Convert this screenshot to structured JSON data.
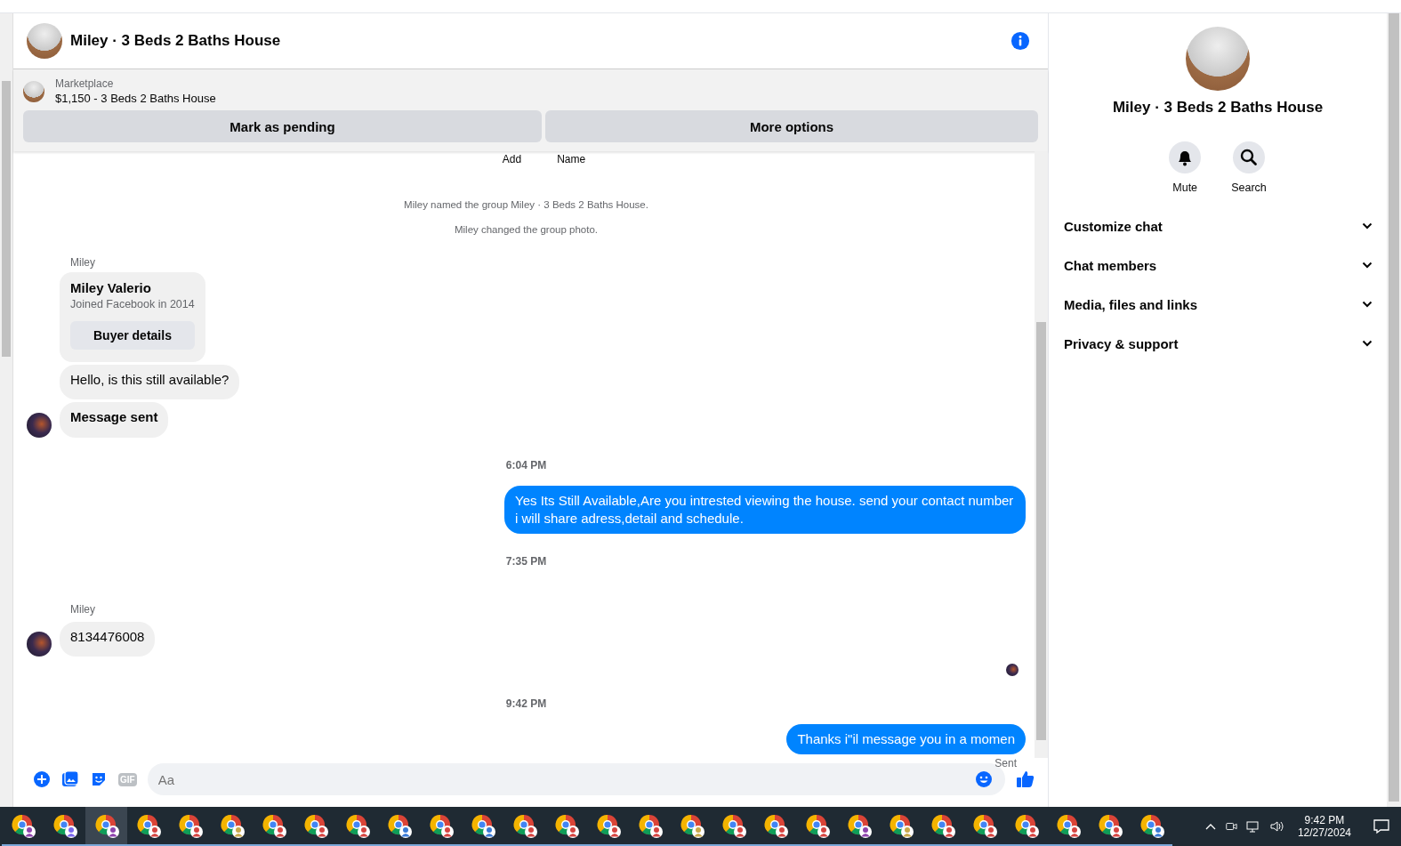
{
  "chat": {
    "title": "Miley · 3 Beds 2 Baths House",
    "listing": {
      "label": "Marketplace",
      "title": "$1,150 - 3 Beds 2 Baths House"
    },
    "actions": [
      "Mark as pending",
      "More options"
    ],
    "clipped": [
      "Add",
      "Name"
    ],
    "messages": [
      {
        "kind": "system",
        "text": "Miley named the group Miley · 3 Beds 2 Baths House."
      },
      {
        "kind": "system",
        "text": "Miley changed the group photo."
      },
      {
        "kind": "sender",
        "text": "Miley"
      },
      {
        "kind": "card",
        "name": "Miley Valerio",
        "subtitle": "Joined Facebook in 2014",
        "button": "Buyer details"
      },
      {
        "kind": "incoming",
        "text": "Hello, is this still available?",
        "avatar": false,
        "bold": false
      },
      {
        "kind": "incoming",
        "text": "Message sent",
        "avatar": true,
        "bold": true
      },
      {
        "kind": "time",
        "text": "6:04 PM"
      },
      {
        "kind": "outgoing",
        "text": "Yes Its Still Available,Are you intrested viewing the house. send your contact number i will share adress,detail and schedule."
      },
      {
        "kind": "time",
        "text": "7:35 PM"
      },
      {
        "kind": "sender",
        "text": "Miley"
      },
      {
        "kind": "incoming",
        "text": "8134476008",
        "avatar": true,
        "bold": false
      },
      {
        "kind": "seen"
      },
      {
        "kind": "time",
        "text": "9:42 PM"
      },
      {
        "kind": "outgoing",
        "text": "Thanks i\"il message you in a momen"
      },
      {
        "kind": "status",
        "text": "Sent"
      }
    ],
    "composer": {
      "gif": "GIF",
      "placeholder": "Aa"
    }
  },
  "details": {
    "title": "Miley · 3 Beds 2 Baths House",
    "actions": [
      {
        "kind": "mute",
        "label": "Mute"
      },
      {
        "kind": "search",
        "label": "Search"
      }
    ],
    "sections": [
      {
        "label": "Customize chat",
        "expanded": false
      },
      {
        "label": "Chat members",
        "expanded": false
      },
      {
        "label": "Media, files and links",
        "expanded": false
      },
      {
        "label": "Privacy & support",
        "expanded": false
      }
    ]
  },
  "taskbar": {
    "apps": [
      {
        "color": "#8e44ad",
        "selected": false
      },
      {
        "color": "#7b68ee",
        "selected": false
      },
      {
        "color": "#8e44ad",
        "selected": true
      },
      {
        "color": "#d64541",
        "selected": false
      },
      {
        "color": "#d64541",
        "selected": false
      },
      {
        "color": "#c9a94b",
        "selected": false
      },
      {
        "color": "#d64541",
        "selected": false
      },
      {
        "color": "#d64541",
        "selected": false
      },
      {
        "color": "#d64541",
        "selected": false
      },
      {
        "color": "#3a7bd5",
        "selected": false
      },
      {
        "color": "#d64541",
        "selected": false
      },
      {
        "color": "#3a7bd5",
        "selected": false
      },
      {
        "color": "#d64541",
        "selected": false
      },
      {
        "color": "#d64541",
        "selected": false
      },
      {
        "color": "#d64541",
        "selected": false
      },
      {
        "color": "#d64541",
        "selected": false
      },
      {
        "color": "#c9a94b",
        "selected": false
      },
      {
        "color": "#d64541",
        "selected": false
      },
      {
        "color": "#d64541",
        "selected": false
      },
      {
        "color": "#d64541",
        "selected": false
      },
      {
        "color": "#8e44ad",
        "selected": false
      },
      {
        "color": "#c9a94b",
        "selected": false
      },
      {
        "color": "#d64541",
        "selected": false
      },
      {
        "color": "#d64541",
        "selected": false
      },
      {
        "color": "#d64541",
        "selected": false
      },
      {
        "color": "#d64541",
        "selected": false
      },
      {
        "color": "#d64541",
        "selected": false
      },
      {
        "color": "#3a7bd5",
        "selected": false
      }
    ],
    "time": "9:42 PM",
    "date": "12/27/2024"
  }
}
